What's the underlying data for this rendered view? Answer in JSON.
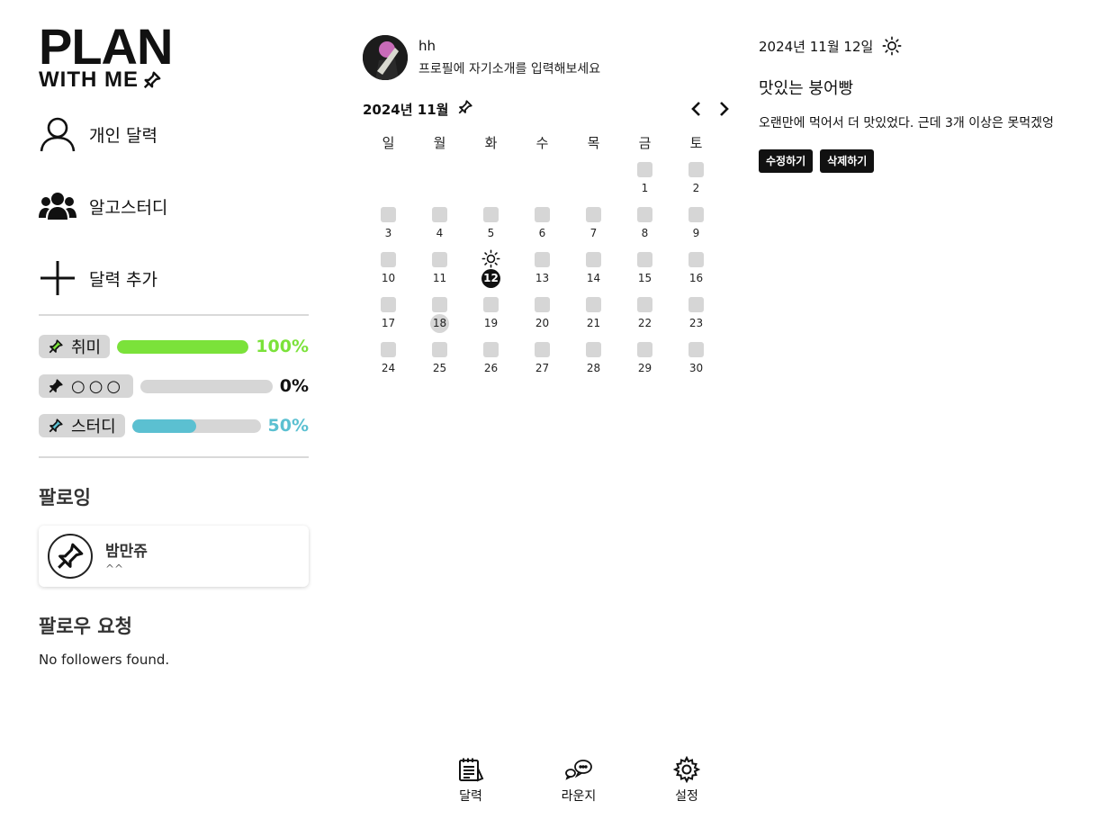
{
  "logo": {
    "line1": "PLAN",
    "line2": "WITH ME"
  },
  "sidebar": {
    "nav": [
      {
        "label": "개인 달력",
        "icon": "user-icon"
      },
      {
        "label": "알고스터디",
        "icon": "group-icon"
      },
      {
        "label": "달력 추가",
        "icon": "plus-icon"
      }
    ],
    "goals": [
      {
        "label": "취미",
        "percent_text": "100%",
        "progress": 1.0,
        "color": "#7be23a",
        "pin": "pin-outline-green-icon"
      },
      {
        "label": "○○○",
        "percent_text": "0%",
        "progress": 0.0,
        "color": "#111111",
        "pin": "pin-filled-icon"
      },
      {
        "label": "스터디",
        "percent_text": "50%",
        "progress": 0.5,
        "color": "#5bc0d1",
        "pin": "pin-outline-blue-icon"
      }
    ],
    "following_title": "팔로잉",
    "following": [
      {
        "name": "밤만쥬",
        "status": "^^"
      }
    ],
    "requests_title": "팔로우 요청",
    "requests_empty": "No followers found."
  },
  "profile": {
    "name": "hh",
    "bio": "프로필에 자기소개를 입력해보세요"
  },
  "calendar": {
    "month_label": "2024년 11월",
    "weekdays": [
      "일",
      "월",
      "화",
      "수",
      "목",
      "금",
      "토"
    ],
    "days": [
      "1",
      "2",
      "3",
      "4",
      "5",
      "6",
      "7",
      "8",
      "9",
      "10",
      "11",
      "12",
      "13",
      "14",
      "15",
      "16",
      "17",
      "18",
      "19",
      "20",
      "21",
      "22",
      "23",
      "24",
      "25",
      "26",
      "27",
      "28",
      "29",
      "30"
    ],
    "today": "12",
    "selected": "18",
    "sun_marked_day": "12"
  },
  "detail": {
    "date": "2024년 11월 12일",
    "weather_icon": "sun-icon",
    "title": "맛있는 붕어빵",
    "body": "오랜만에 먹어서 더 맛있었다. 근데 3개 이상은 못먹겠엉",
    "edit_label": "수정하기",
    "delete_label": "삭제하기"
  },
  "bottom_nav": [
    {
      "label": "달력",
      "icon": "calendar-note-icon"
    },
    {
      "label": "라운지",
      "icon": "chat-bubbles-icon"
    },
    {
      "label": "설정",
      "icon": "gear-icon"
    }
  ]
}
